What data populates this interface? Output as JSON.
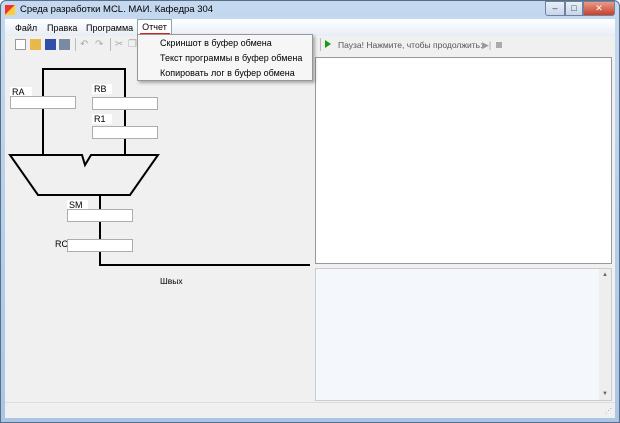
{
  "window": {
    "title": "Среда разработки MCL. МАИ. Кафедра 304"
  },
  "menu": {
    "items": [
      {
        "label": "Файл"
      },
      {
        "label": "Правка"
      },
      {
        "label": "Программа"
      },
      {
        "label": "Отчет"
      }
    ]
  },
  "dropdown": {
    "items": [
      {
        "label": "Скриншот в буфер обмена"
      },
      {
        "label": "Текст программы в буфер обмена"
      },
      {
        "label": "Копировать лог в буфер обмена"
      }
    ]
  },
  "run_toolbar": {
    "status": "Пауза! Нажмите, чтобы продолжить:"
  },
  "diagram": {
    "labels": {
      "ra": "RA",
      "rb": "RB",
      "r1": "R1",
      "sm": "SM",
      "rc": "RC",
      "out": "Швых"
    },
    "values": {
      "ra": "",
      "rb": "",
      "r1": "",
      "sm": "",
      "rc": ""
    }
  },
  "colors": {
    "accent": "#d22222",
    "titlebar": "#b8d1ec"
  }
}
